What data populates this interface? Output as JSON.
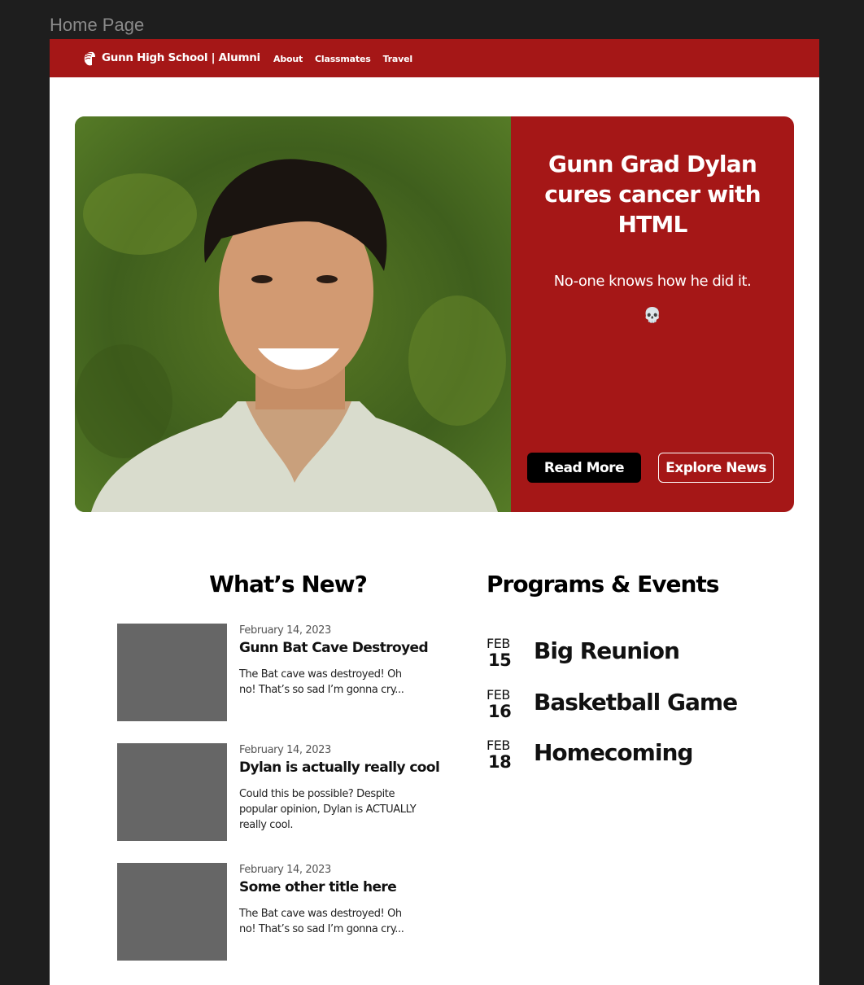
{
  "frame": {
    "label": "Home Page"
  },
  "nav": {
    "logo_icon": "spartan-helmet-icon",
    "brand": "Gunn High School | Alumni",
    "links": [
      "About",
      "Classmates",
      "Travel"
    ]
  },
  "hero": {
    "image_alt": "Portrait of smiling student in white polo shirt",
    "title": "Gunn Grad Dylan cures cancer with HTML",
    "subtitle": "No-one knows how he did it.",
    "emoji": "💀",
    "read_more": "Read More",
    "explore_news": "Explore News"
  },
  "whats_new": {
    "title": "What’s New?",
    "items": [
      {
        "date": "February 14, 2023",
        "title": "Gunn Bat Cave Destroyed",
        "body": "The Bat cave was destroyed! Oh no! That’s so sad I’m gonna cry..."
      },
      {
        "date": "February 14, 2023",
        "title": "Dylan is actually really cool",
        "body": "Could this be possible? Despite popular opinion, Dylan is ACTUALLY really cool."
      },
      {
        "date": "February 14, 2023",
        "title": "Some other title here",
        "body": "The Bat cave was destroyed! Oh no! That’s so sad I’m gonna cry..."
      }
    ]
  },
  "events": {
    "title": "Programs & Events",
    "items": [
      {
        "month": "FEB",
        "day": "15",
        "name": "Big Reunion"
      },
      {
        "month": "FEB",
        "day": "16",
        "name": "Basketball Game"
      },
      {
        "month": "FEB",
        "day": "18",
        "name": "Homecoming"
      }
    ]
  },
  "colors": {
    "brand_red": "#a51717",
    "thumb_gray": "#666666",
    "canvas": "#1e1e1e"
  }
}
